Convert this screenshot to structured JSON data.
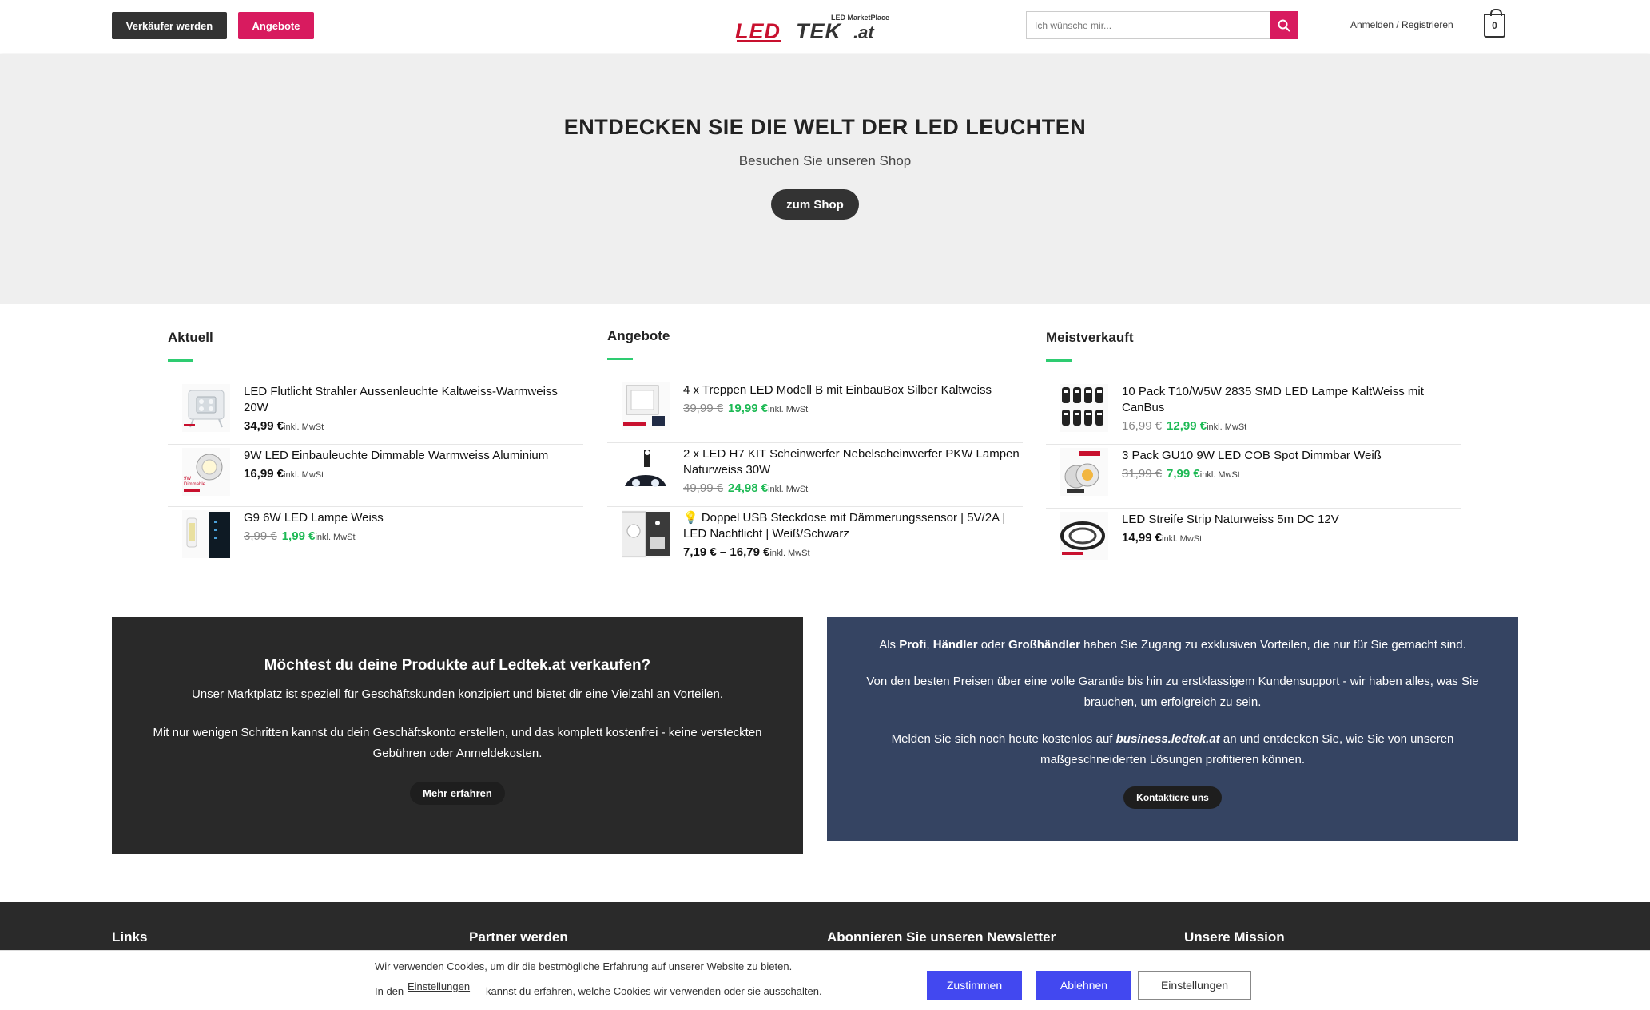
{
  "header": {
    "seller_button": "Verkäufer werden",
    "offers_button": "Angebote",
    "logo_text": "LEDTEK.at",
    "logo_tagline": "LED MarketPlace",
    "search_placeholder": "Ich wünsche mir...",
    "login_link": "Anmelden / Registrieren",
    "cart_count": "0"
  },
  "hero": {
    "title": "ENTDECKEN SIE DIE WELT DER LED LEUCHTEN",
    "subtitle": "Besuchen Sie unseren Shop",
    "button": "zum Shop"
  },
  "columns": [
    {
      "title": "Aktuell",
      "items": [
        {
          "name": "LED Flutlicht Strahler Aussenleuchte Kaltweiss-Warmweiss 20W",
          "old_price": "",
          "price": "34,99 €",
          "sale": false,
          "tax": "inkl. MwSt"
        },
        {
          "name": "9W LED Einbauleuchte Dimmable Warmweiss Aluminium",
          "old_price": "",
          "price": "16,99 €",
          "sale": false,
          "tax": "inkl. MwSt"
        },
        {
          "name": "G9 6W LED Lampe Weiss",
          "old_price": "3,99 €",
          "price": "1,99 €",
          "sale": true,
          "tax": "inkl. MwSt"
        }
      ]
    },
    {
      "title": "Angebote",
      "items": [
        {
          "name": "4 x Treppen LED Modell B mit EinbauBox Silber Kaltweiss",
          "old_price": "39,99 €",
          "price": "19,99 €",
          "sale": true,
          "tax": "inkl. MwSt"
        },
        {
          "name": "2 x LED H7 KIT Scheinwerfer Nebelscheinwerfer PKW Lampen Naturweiss 30W",
          "old_price": "49,99 €",
          "price": "24,98 €",
          "sale": true,
          "tax": "inkl. MwSt"
        },
        {
          "name": "💡 Doppel USB Steckdose mit Dämmerungssensor | 5V/2A | LED Nachtlicht | Weiß/Schwarz",
          "old_price": "",
          "price": "7,19 € – 16,79 €",
          "sale": false,
          "tax": "inkl. MwSt"
        }
      ]
    },
    {
      "title": "Meistverkauft",
      "items": [
        {
          "name": "10 Pack T10/W5W 2835 SMD LED Lampe KaltWeiss mit CanBus",
          "old_price": "16,99 €",
          "price": "12,99 €",
          "sale": true,
          "tax": "inkl. MwSt"
        },
        {
          "name": "3 Pack GU10 9W LED COB Spot Dimmbar Weiß",
          "old_price": "31,99 €",
          "price": "7,99 €",
          "sale": true,
          "tax": "inkl. MwSt"
        },
        {
          "name": "LED Streife Strip Naturweiss 5m DC 12V",
          "old_price": "",
          "price": "14,99 €",
          "sale": false,
          "tax": "inkl. MwSt"
        }
      ]
    }
  ],
  "promo_seller": {
    "title": "Möchtest du deine Produkte auf Ledtek.at verkaufen?",
    "p1": "Unser Marktplatz ist speziell für Geschäftskunden konzipiert und bietet dir eine Vielzahl an Vorteilen.",
    "p2": "Mit nur wenigen Schritten kannst du dein Geschäftskonto erstellen, und das komplett kostenfrei - keine versteckten Gebühren oder Anmeldekosten.",
    "button": "Mehr erfahren"
  },
  "promo_business": {
    "p1_a": "Als ",
    "p1_b1": "Profi",
    "p1_c": ", ",
    "p1_b2": "Händler",
    "p1_d": " oder ",
    "p1_b3": "Großhändler",
    "p1_e": " haben Sie Zugang zu exklusiven Vorteilen, die nur für Sie gemacht sind.",
    "p2": "Von den besten Preisen über eine volle Garantie bis hin zu erstklassigem Kundensupport - wir haben alles, was Sie brauchen, um erfolgreich zu sein.",
    "p3_a": "Melden Sie sich noch heute kostenlos auf ",
    "p3_link": "business.ledtek.at",
    "p3_b": " an und entdecken Sie, wie Sie von unseren maßgeschneiderten Lösungen profitieren können.",
    "button": "Kontaktiere uns"
  },
  "footer": {
    "col1": "Links",
    "col2": "Partner werden",
    "col3": "Abonnieren Sie unseren Newsletter",
    "col4": "Unsere Mission"
  },
  "cookie": {
    "line1": "Wir verwenden Cookies, um dir die bestmögliche Erfahrung auf unserer Website zu bieten.",
    "line2_a": "In den",
    "line2_link": "Einstellungen",
    "line2_b": "kannst du erfahren, welche Cookies wir verwenden oder sie ausschalten.",
    "accept": "Zustimmen",
    "decline": "Ablehnen",
    "settings": "Einstellungen"
  },
  "colors": {
    "accent_pink": "#d81b5f",
    "sale_green": "#1db954",
    "business_blue": "#354462",
    "cookie_blue": "#4248f0"
  }
}
